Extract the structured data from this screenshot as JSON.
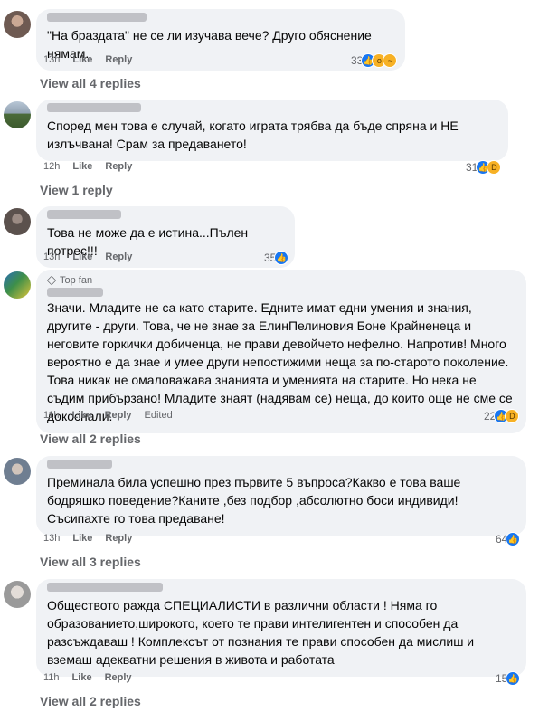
{
  "comments": [
    {
      "text": "\"На браздата\" не се ли изучава вече? Друго обяснение нямам.",
      "time": "13h",
      "like": "Like",
      "reply": "Reply",
      "edited": "",
      "reactions_count": "33",
      "reaction_icons": [
        "like-icon",
        "wow-icon",
        "sad-icon"
      ],
      "top_fan": "",
      "view_replies": "View all 4 replies"
    },
    {
      "text": "Според мен това е случай, когато играта трябва да бъде спряна и НЕ излъчвана! Срам за предаването!",
      "time": "12h",
      "like": "Like",
      "reply": "Reply",
      "edited": "",
      "reactions_count": "31",
      "reaction_icons": [
        "like-icon",
        "haha-icon"
      ],
      "top_fan": "",
      "view_replies": "View 1 reply"
    },
    {
      "text": "Това не може да е истина...Пълен потрес!!!",
      "time": "13h",
      "like": "Like",
      "reply": "Reply",
      "edited": "",
      "reactions_count": "35",
      "reaction_icons": [
        "like-icon"
      ],
      "top_fan": "",
      "view_replies": ""
    },
    {
      "text": "Значи. Младите не са като старите. Едните имат едни умения и знания, другите - други. Това, че не знае за ЕлинПелиновия Боне Крайненеца и неговите горкички добиченца, не прави девойчето нефелно. Напротив! Много вероятно е да знае и умее други непостижими неща за по-старото поколение. Това никак не омаловажава знанията и уменията на старите. Но нека не съдим прибързано! Младите знаят (надявам се) неща, до които още не сме се докоснали.",
      "time": "11h",
      "like": "Like",
      "reply": "Reply",
      "edited": "Edited",
      "reactions_count": "22",
      "reaction_icons": [
        "like-icon",
        "haha-icon"
      ],
      "top_fan": "Top fan",
      "view_replies": "View all 2 replies"
    },
    {
      "text": "Преминала била успешно през първите 5 въпроса?Какво е това ваше бодряшко поведение?Каните ,без подбор ,абсолютно боси индивиди!Съсипахте го това предаване!",
      "time": "13h",
      "like": "Like",
      "reply": "Reply",
      "edited": "",
      "reactions_count": "64",
      "reaction_icons": [
        "like-icon"
      ],
      "top_fan": "",
      "view_replies": "View all 3 replies"
    },
    {
      "text": "Обществото ражда СПЕЦИАЛИСТИ в различни области ! Няма го образованието,широкото, което те прави интелигентен и способен да разсъждаваш ! Комплексът от познания те прави способен да мислиш и вземаш адекватни решения в живота и работата",
      "time": "11h",
      "like": "Like",
      "reply": "Reply",
      "edited": "",
      "reactions_count": "15",
      "reaction_icons": [
        "like-icon"
      ],
      "top_fan": "",
      "view_replies": "View all 2 replies"
    }
  ],
  "colors": {
    "bubble": "#f0f2f5",
    "meta": "#65676b",
    "like_blue": "#1877f2"
  }
}
